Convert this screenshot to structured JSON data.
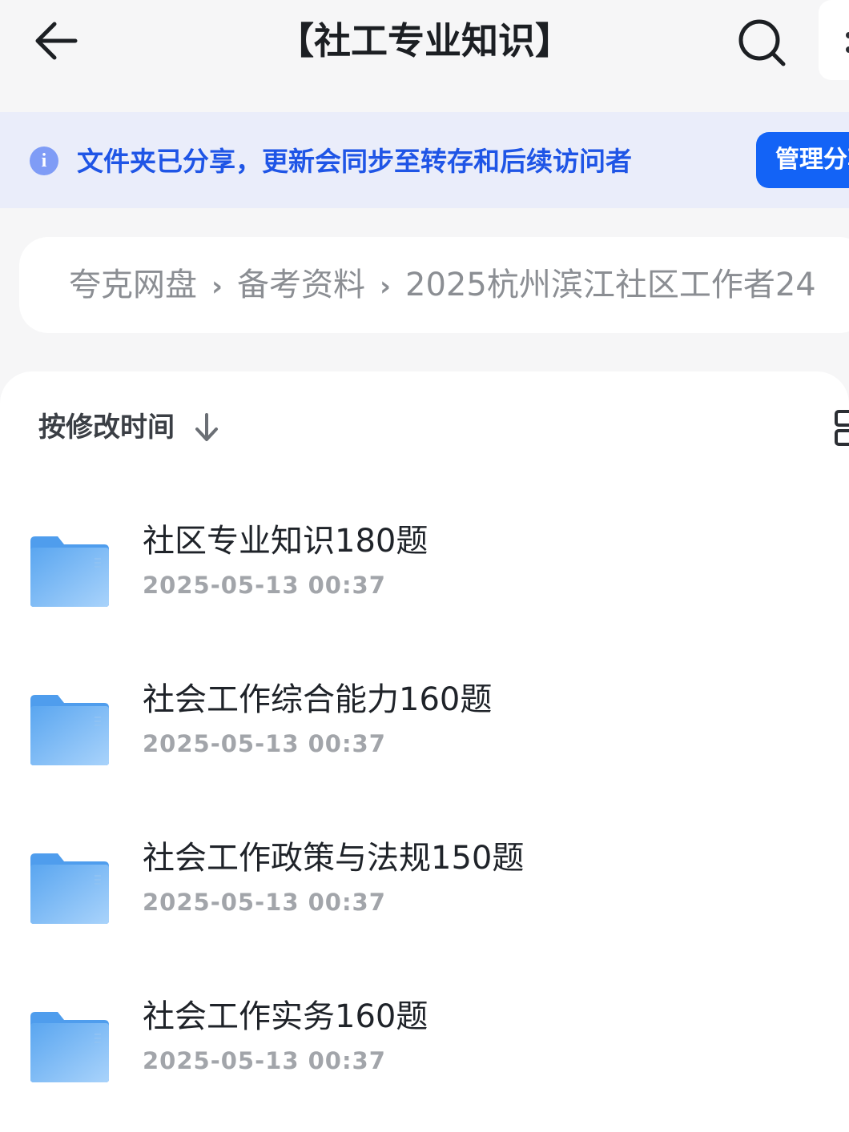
{
  "header": {
    "title": "【社工专业知识】",
    "back_icon": "arrow-left-icon",
    "search_icon": "search-icon",
    "more_icon": "more-vertical-icon"
  },
  "share_banner": {
    "icon": "info-icon",
    "icon_glyph": "i",
    "text": "文件夹已分享，更新会同步至转存和后续访问者",
    "manage_button_label": "管理分享"
  },
  "breadcrumb": {
    "items": [
      "夸克网盘",
      "备考资料",
      "2025杭州滨江社区工作者24"
    ],
    "separator": "›"
  },
  "list_header": {
    "sort_label": "按修改时间",
    "sort_direction_icon": "arrow-down-icon",
    "view_toggle_icon": "grid-view-icon"
  },
  "files": [
    {
      "name": "社区专业知识180题",
      "modified": "2025-05-13 00:37",
      "type": "folder"
    },
    {
      "name": "社会工作综合能力160题",
      "modified": "2025-05-13 00:37",
      "type": "folder"
    },
    {
      "name": "社会工作政策与法规150题",
      "modified": "2025-05-13 00:37",
      "type": "folder"
    },
    {
      "name": "社会工作实务160题",
      "modified": "2025-05-13 00:37",
      "type": "folder"
    }
  ],
  "colors": {
    "accent": "#1363f6",
    "banner_bg": "#eaedfa",
    "banner_text": "#1f55e6",
    "folder": "#7db8f3"
  }
}
